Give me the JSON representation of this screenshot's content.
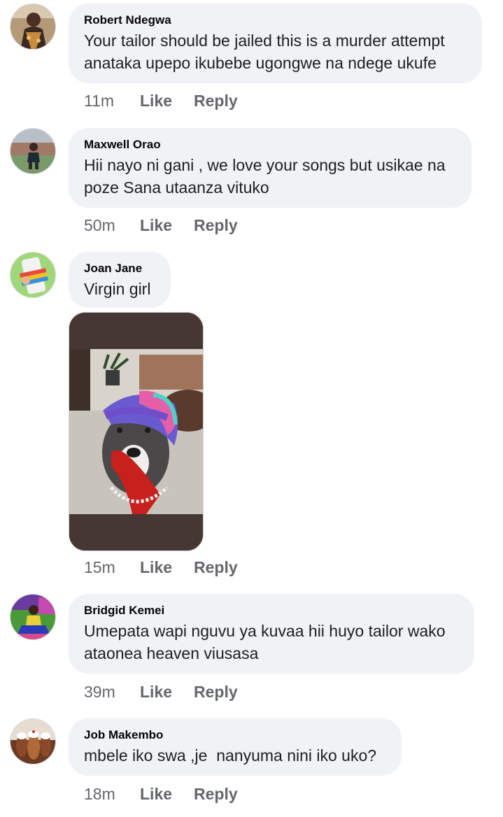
{
  "comments": [
    {
      "author": "Robert Ndegwa",
      "text": "Your tailor should be jailed this is a murder attempt anataka upepo ikubebe ugongwe na ndege ukufe",
      "time": "11m",
      "like_label": "Like",
      "reply_label": "Reply"
    },
    {
      "author": "Maxwell Orao",
      "text": "Hii nayo ni gani , we love your songs but usikae na poze Sana utaanza vituko",
      "time": "50m",
      "like_label": "Like",
      "reply_label": "Reply"
    },
    {
      "author": "Joan Jane",
      "text": "Virgin girl",
      "time": "15m",
      "like_label": "Like",
      "reply_label": "Reply",
      "attachment": "sticker-image"
    },
    {
      "author": "Bridgid Kemei",
      "text": "Umepata wapi nguvu ya kuvaa hii huyo tailor wako ataonea heaven viusasa",
      "time": "39m",
      "like_label": "Like",
      "reply_label": "Reply"
    },
    {
      "author": "Job Makembo",
      "text": "mbele iko swa ,je  nanyuma nini iko uko?",
      "time": "18m",
      "like_label": "Like",
      "reply_label": "Reply"
    }
  ],
  "colors": {
    "bubble": "#f0f2f5",
    "meta": "#65676b",
    "author": "#050505",
    "attachment_frame": "#463734"
  }
}
